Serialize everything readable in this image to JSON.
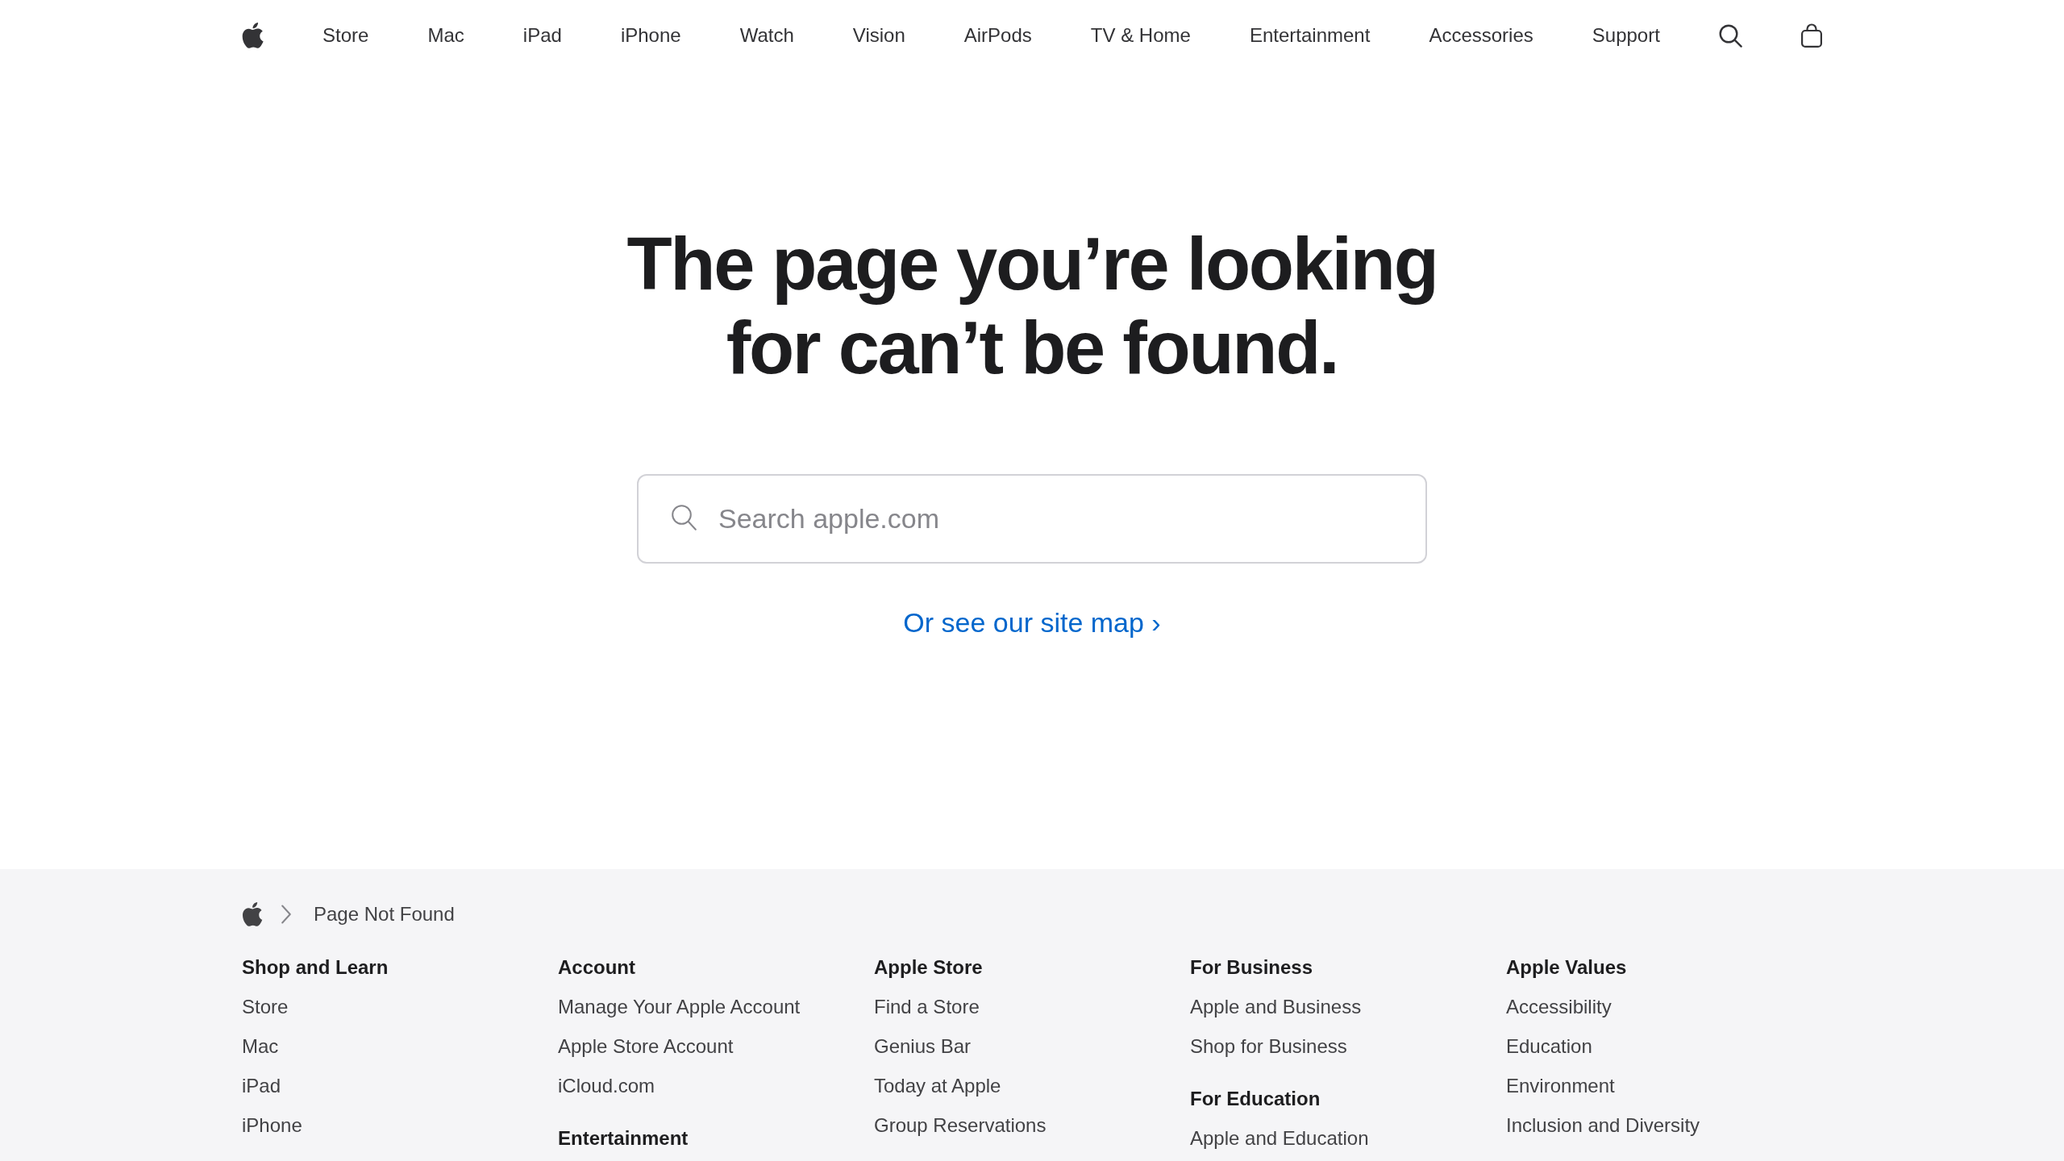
{
  "nav": {
    "items": [
      "Store",
      "Mac",
      "iPad",
      "iPhone",
      "Watch",
      "Vision",
      "AirPods",
      "TV & Home",
      "Entertainment",
      "Accessories",
      "Support"
    ]
  },
  "headline": "The page you’re looking for can’t be found.",
  "search": {
    "placeholder": "Search apple.com"
  },
  "site_map_link": "Or see our site map ›",
  "breadcrumb": {
    "current": "Page Not Found"
  },
  "footer": {
    "columns": [
      {
        "sections": [
          {
            "heading": "Shop and Learn",
            "links": [
              "Store",
              "Mac",
              "iPad",
              "iPhone"
            ]
          }
        ]
      },
      {
        "sections": [
          {
            "heading": "Account",
            "links": [
              "Manage Your Apple Account",
              "Apple Store Account",
              "iCloud.com"
            ]
          },
          {
            "heading": "Entertainment"
          }
        ]
      },
      {
        "sections": [
          {
            "heading": "Apple Store",
            "links": [
              "Find a Store",
              "Genius Bar",
              "Today at Apple",
              "Group Reservations"
            ]
          }
        ]
      },
      {
        "sections": [
          {
            "heading": "For Business",
            "links": [
              "Apple and Business",
              "Shop for Business"
            ]
          },
          {
            "heading": "For Education",
            "links": [
              "Apple and Education"
            ]
          }
        ]
      },
      {
        "sections": [
          {
            "heading": "Apple Values",
            "links": [
              "Accessibility",
              "Education",
              "Environment",
              "Inclusion and Diversity"
            ]
          }
        ]
      }
    ]
  }
}
